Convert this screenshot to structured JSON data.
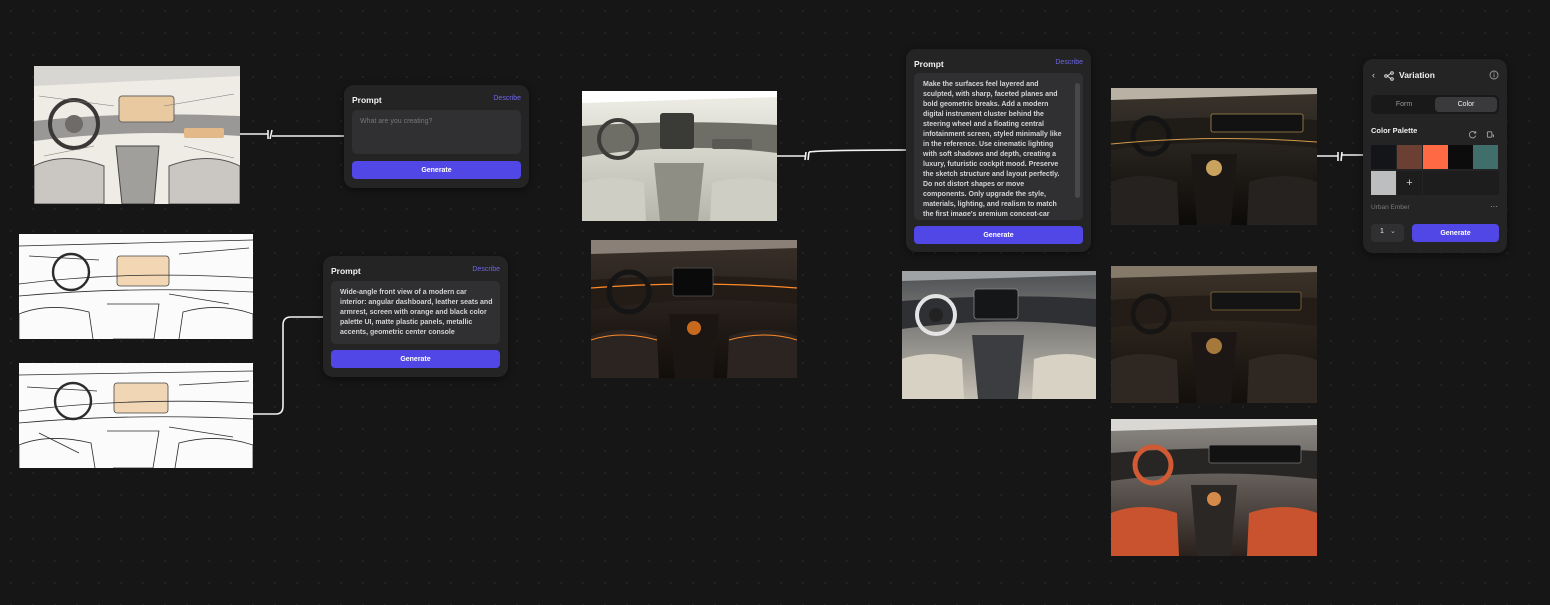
{
  "nodes": {
    "prompt1": {
      "title": "Prompt",
      "link": "Describe",
      "placeholder": "What are you creating?",
      "button": "Generate"
    },
    "prompt2": {
      "title": "Prompt",
      "link": "Describe",
      "text": "Wide-angle front view of a modern car interior: angular dashboard, leather seats and armrest, screen with orange and black color palette UI, matte plastic panels, metallic accents, geometric center console",
      "button": "Generate"
    },
    "prompt3": {
      "title": "Prompt",
      "link": "Describe",
      "text": "Make the surfaces feel layered and sculpted, with sharp, faceted planes and bold geometric breaks. Add a modern digital instrument cluster behind the steering wheel and a floating central infotainment screen, styled minimally like in the reference. Use cinematic lighting with soft shadows and depth, creating a luxury, futuristic cockpit mood. Preserve the sketch structure and layout perfectly. Do not distort shapes or move components. Only upgrade the style, materials, lighting, and realism to match the first image's premium concept-car",
      "button": "Generate"
    }
  },
  "variation": {
    "title": "Variation",
    "tabs": [
      "Form",
      "Color"
    ],
    "active_tab": "Color",
    "palette_label": "Color Palette",
    "palette_name": "Urban Ember",
    "swatches": [
      "#141518",
      "#6b4033",
      "#ff6a45",
      "#0c0c0d",
      "#3f6e6b",
      "#bdbebf"
    ],
    "add_symbol": "+",
    "more_symbol": "···",
    "count": "1",
    "button": "Generate",
    "icons": [
      "chevron-left-icon",
      "branch-icon",
      "info-icon",
      "refresh-icon",
      "bucket-icon",
      "chevron-down-icon"
    ]
  },
  "images": [
    {
      "name": "sketch-shaded",
      "style": "sketch-warm"
    },
    {
      "name": "sketch-lineart-1",
      "style": "lineart"
    },
    {
      "name": "sketch-lineart-2",
      "style": "lineart"
    },
    {
      "name": "render-greyscale",
      "style": "greyscale"
    },
    {
      "name": "render-dark-orange",
      "style": "dark-orange"
    },
    {
      "name": "render-light",
      "style": "light"
    },
    {
      "name": "variation-1",
      "style": "dark-gold"
    },
    {
      "name": "variation-2",
      "style": "dark-brown"
    },
    {
      "name": "variation-3",
      "style": "orange-seats"
    }
  ]
}
